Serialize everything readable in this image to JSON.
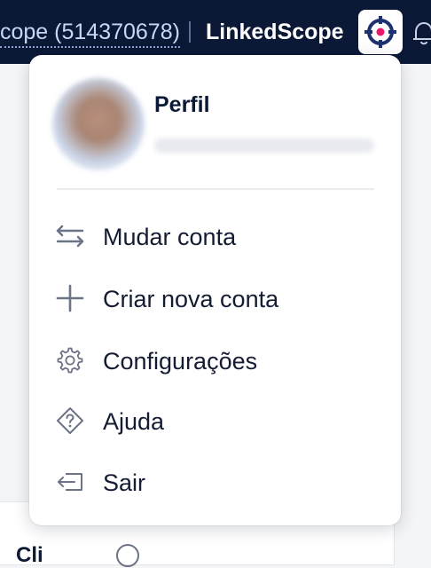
{
  "topbar": {
    "account_link": "cope (514370678)",
    "app_name": "LinkedScope",
    "colors": {
      "background": "#0b1936",
      "logo_accent": "#e8196d",
      "logo_ring": "#1d3170"
    },
    "icons": {
      "app_logo": "crosshair-logo-icon",
      "notifications": "bell-icon"
    }
  },
  "background_page": {
    "card_title_partial": "Cli",
    "icons": {
      "info": "info-icon"
    }
  },
  "dropdown": {
    "profile": {
      "title": "Perfil",
      "avatar": "avatar"
    },
    "items": [
      {
        "label": "Mudar conta",
        "icon": "swap-arrows-icon"
      },
      {
        "label": "Criar nova conta",
        "icon": "plus-icon"
      },
      {
        "label": "Configurações",
        "icon": "gear-icon"
      },
      {
        "label": "Ajuda",
        "icon": "help-diamond-icon"
      },
      {
        "label": "Sair",
        "icon": "logout-icon"
      }
    ]
  }
}
